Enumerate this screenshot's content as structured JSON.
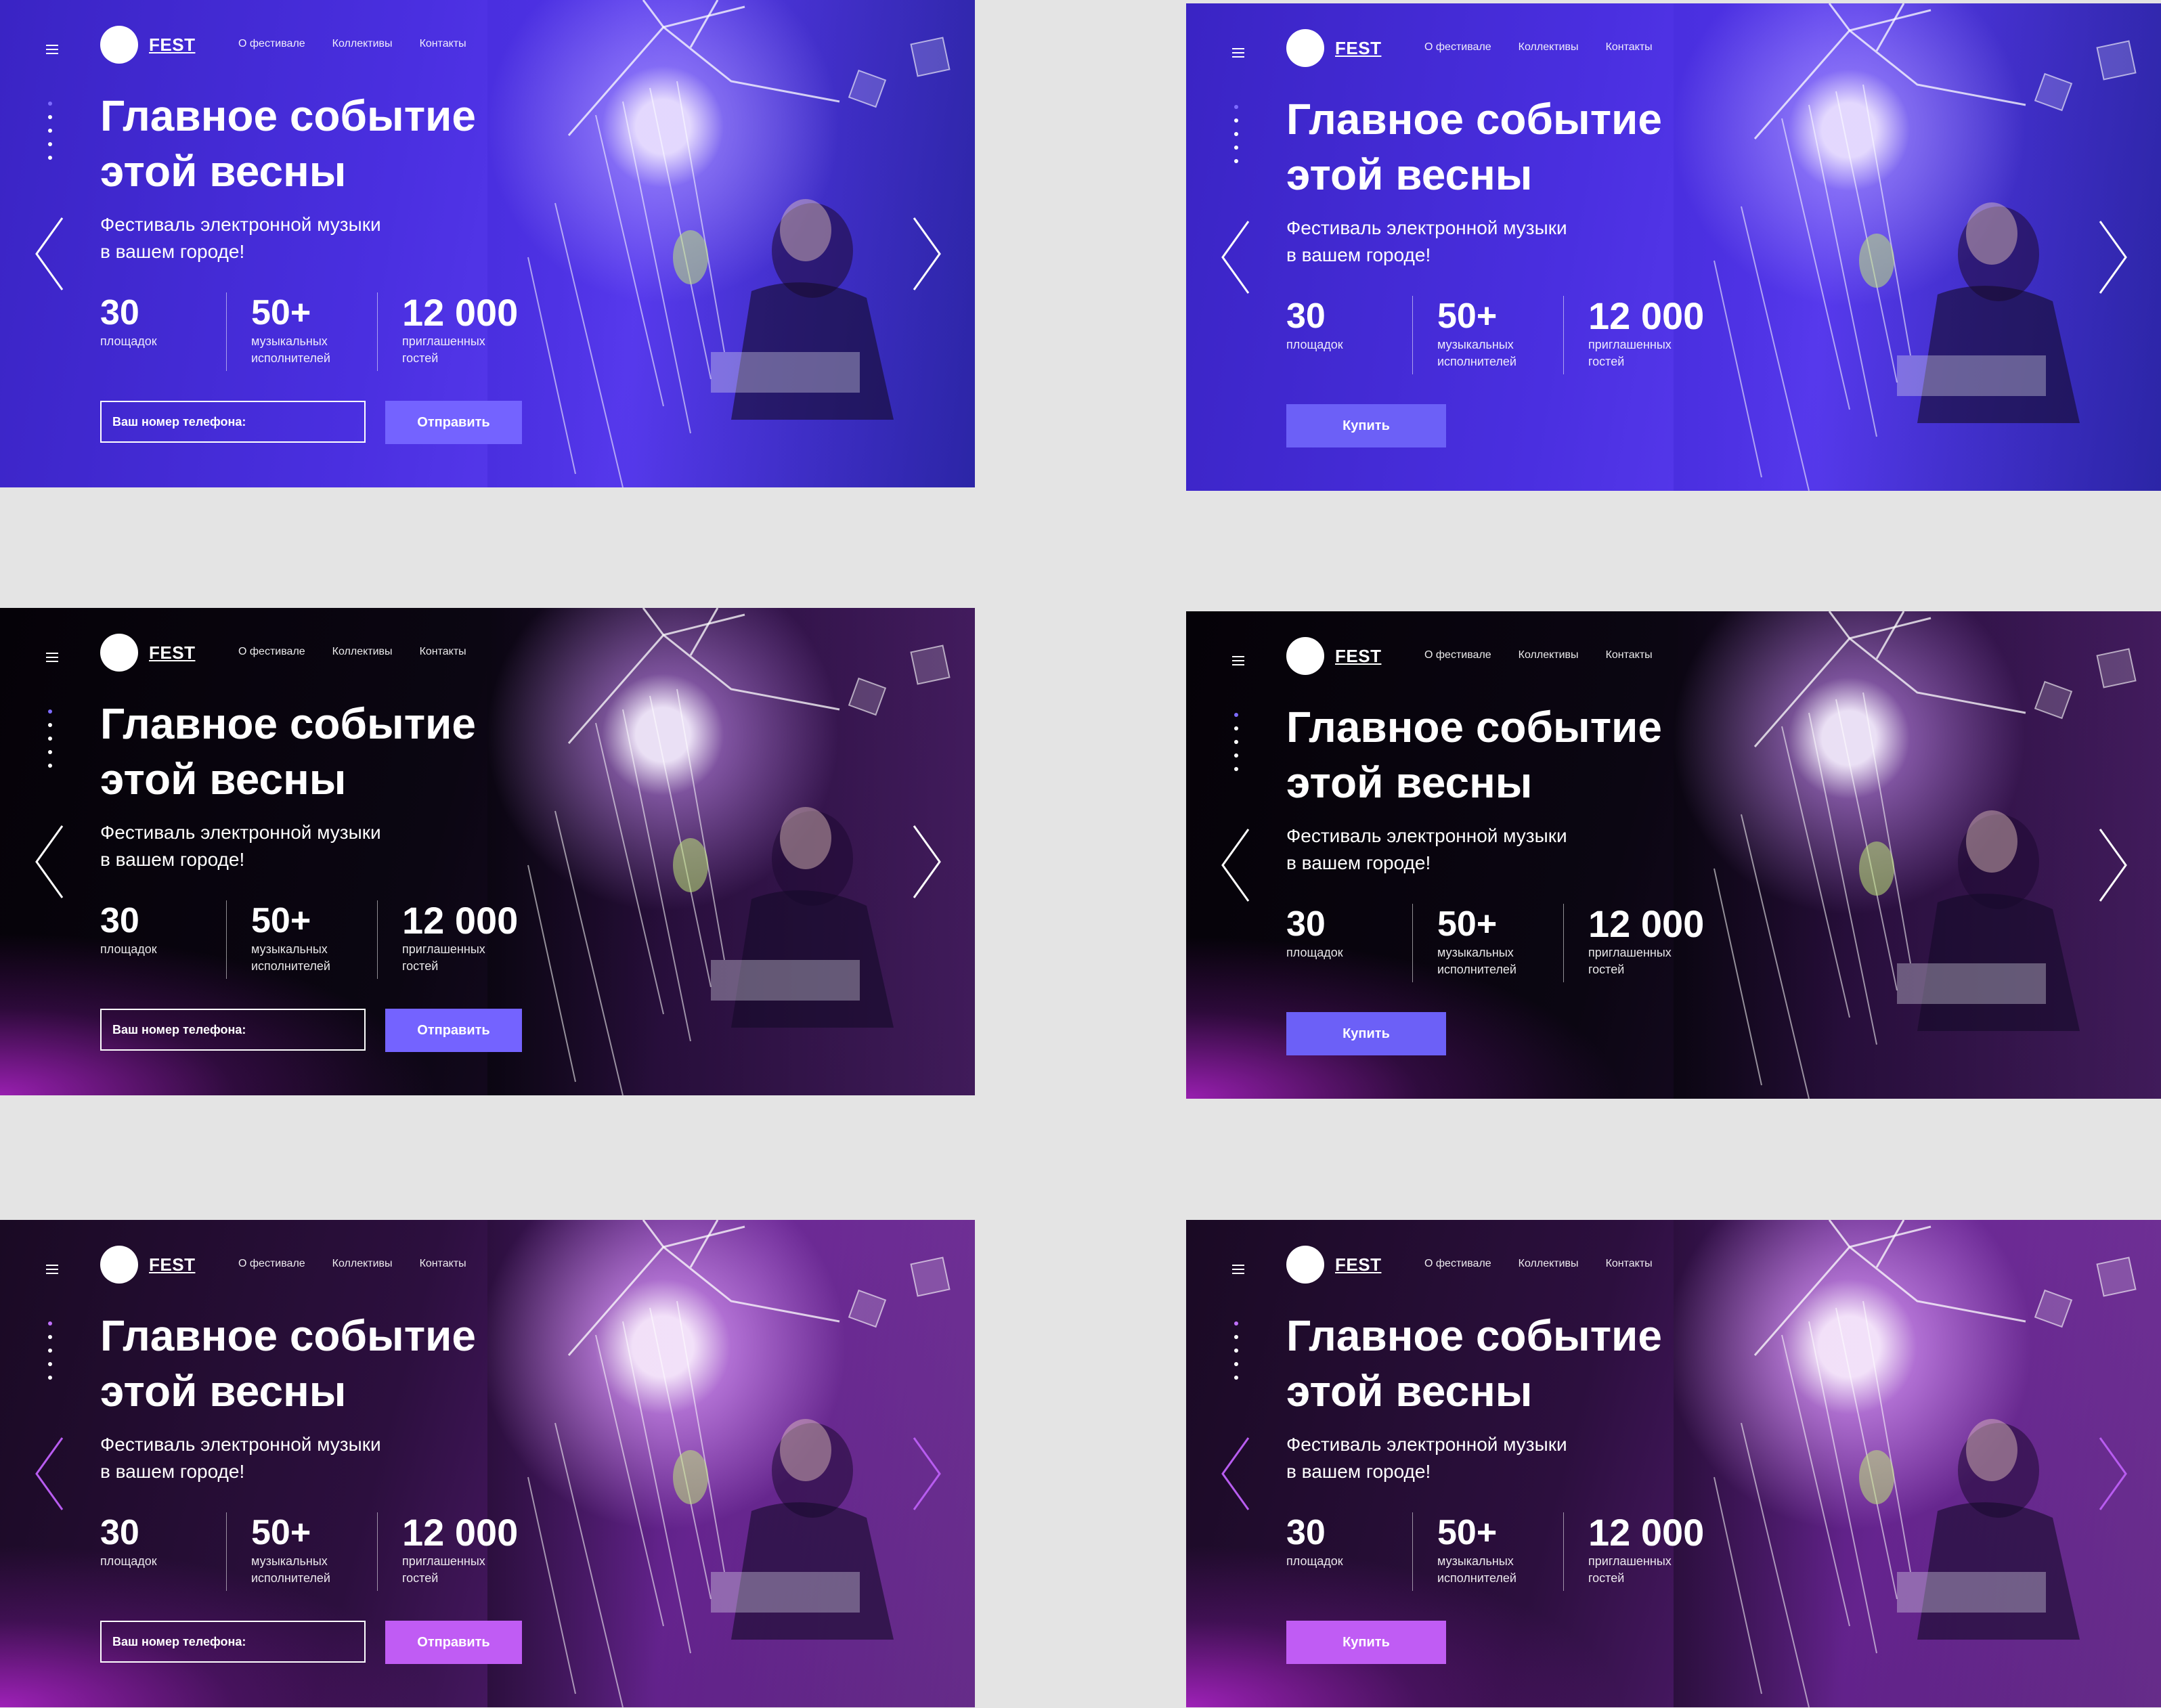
{
  "header": {
    "brand": "FEST",
    "nav": [
      "О фестивале",
      "Коллективы",
      "Контакты"
    ]
  },
  "hero": {
    "title_line1": "Главное событие",
    "title_line2": "этой весны",
    "subtitle_line1": "Фестиваль электронной музыки",
    "subtitle_line2": "в вашем городе!"
  },
  "stats": [
    {
      "value": "30",
      "label_line1": "площадок",
      "label_line2": ""
    },
    {
      "value": "50+",
      "label_line1": "музыкальных",
      "label_line2": "исполнителей"
    },
    {
      "value": "12 000",
      "label_line1": "приглашенных",
      "label_line2": "гостей"
    }
  ],
  "form": {
    "phone_placeholder": "Ваш номер телефона:",
    "submit_label": "Отправить",
    "buy_label": "Купить"
  },
  "slider": {
    "dot_count": 5,
    "active_dot": 1
  },
  "colors": {
    "blue_bg": "#4a2fe0",
    "dark_bg": "#0b0612",
    "purple_bg": "#2c0f3e",
    "accent_button": "#7463ff",
    "accent_button_purple": "#c05cf4",
    "page_bg": "#e4e4e4"
  },
  "variants": [
    {
      "theme": "blue",
      "cta": "form"
    },
    {
      "theme": "blue",
      "cta": "buy"
    },
    {
      "theme": "dark",
      "cta": "form"
    },
    {
      "theme": "dark",
      "cta": "buy"
    },
    {
      "theme": "purple",
      "cta": "form"
    },
    {
      "theme": "purple",
      "cta": "buy"
    }
  ],
  "icons": [
    "menu-icon",
    "logo-circle-icon",
    "chevron-left-icon",
    "chevron-right-icon"
  ]
}
